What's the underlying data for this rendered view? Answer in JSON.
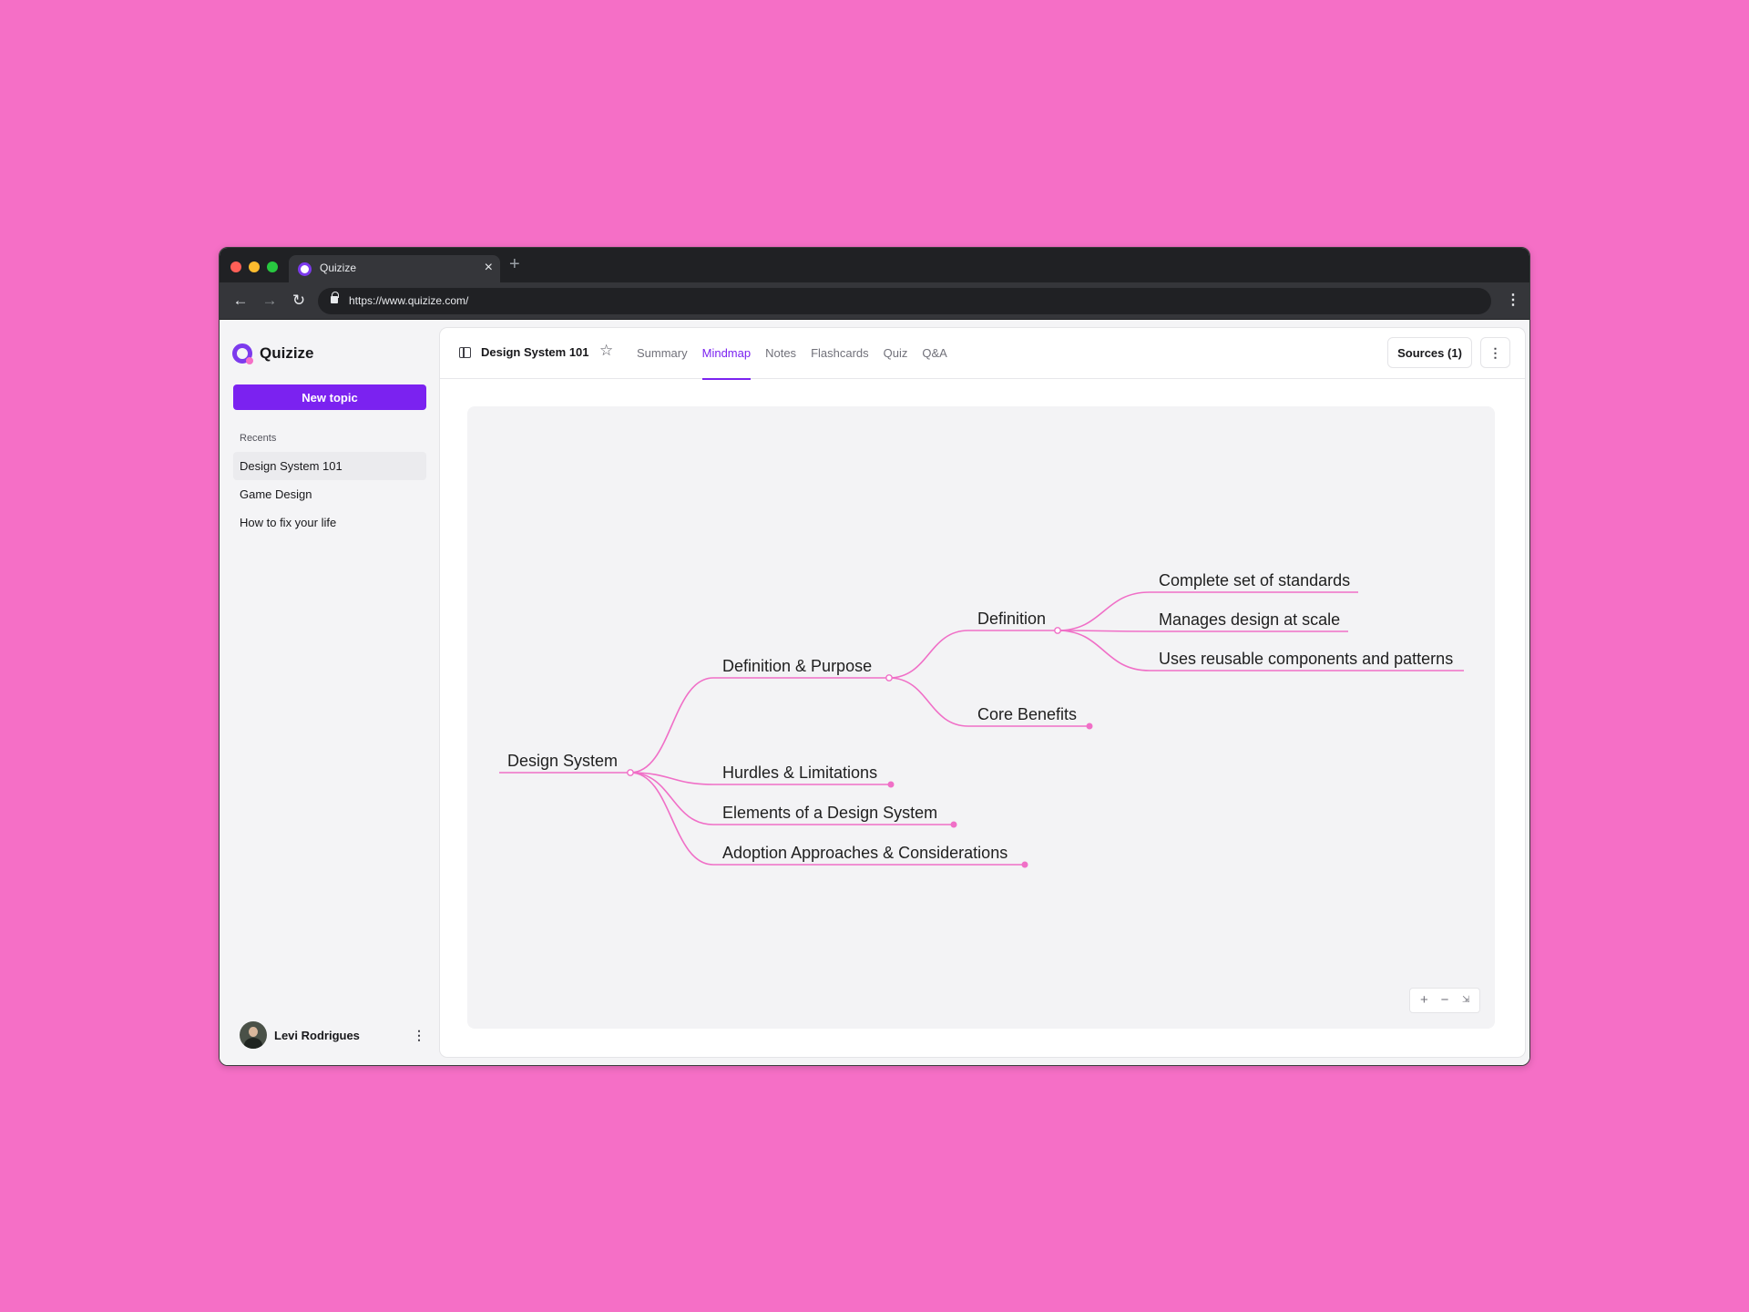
{
  "browser": {
    "tab_title": "Quizize",
    "url": "https://www.quizize.com/"
  },
  "sidebar": {
    "logo": "Quizize",
    "new_topic": "New topic",
    "recents_label": "Recents",
    "recents": [
      "Design System 101",
      "Game Design",
      "How to fix your life"
    ],
    "active_recent": "Design System 101",
    "user": {
      "name": "Levi Rodrigues"
    }
  },
  "header": {
    "title": "Design System 101",
    "tabs": [
      "Summary",
      "Mindmap",
      "Notes",
      "Flashcards",
      "Quiz",
      "Q&A"
    ],
    "active_tab": "Mindmap",
    "sources_label": "Sources (1)"
  },
  "mindmap": {
    "root": "Design System",
    "children": [
      {
        "label": "Definition & Purpose",
        "children": [
          {
            "label": "Definition",
            "children": [
              {
                "label": "Complete set of standards"
              },
              {
                "label": "Manages design at scale"
              },
              {
                "label": "Uses reusable components and patterns"
              }
            ]
          },
          {
            "label": "Core Benefits"
          }
        ]
      },
      {
        "label": "Hurdles & Limitations"
      },
      {
        "label": "Elements of a Design System"
      },
      {
        "label": "Adoption Approaches & Considerations"
      }
    ]
  },
  "zoom_controls": {
    "zoom_in": "+",
    "zoom_out": "−",
    "fit": "⇲"
  },
  "colors": {
    "accent": "#7b22f0",
    "mindmap_line": "#f06fc7",
    "background": "#f56fc6"
  }
}
